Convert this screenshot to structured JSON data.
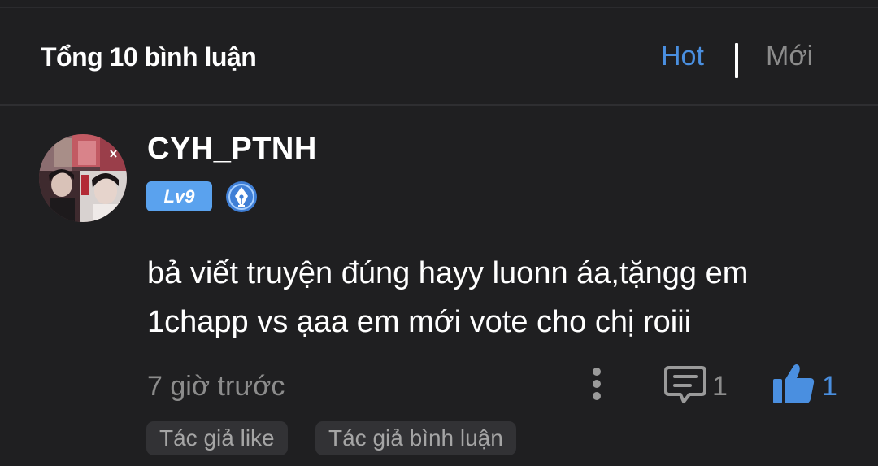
{
  "header": {
    "title": "Tổng 10 bình luận",
    "sort_hot_label": "Hot",
    "sort_new_label": "Mới"
  },
  "comment": {
    "username": "CYH_PTNH",
    "level_label": "Lv9",
    "text_lines": [
      "bả viết truyện đúng hayy luonn áa,tặngg em",
      "1chapp vs ạaa em mới vote cho chị roiii"
    ],
    "timestamp": "7 giờ trước",
    "reply_count": "1",
    "like_count": "1",
    "tags": [
      "Tác giả like",
      "Tác giả bình luận"
    ]
  },
  "icons": {
    "more": "more-vertical-icon",
    "reply": "comment-icon",
    "like": "thumbs-up-icon",
    "badge": "pen-nib-icon"
  },
  "colors": {
    "background": "#1f1f21",
    "accent": "#4a8fe0",
    "muted": "#8c8c8c",
    "level_badge": "#5aa2ee",
    "tag_bg": "#323235"
  }
}
